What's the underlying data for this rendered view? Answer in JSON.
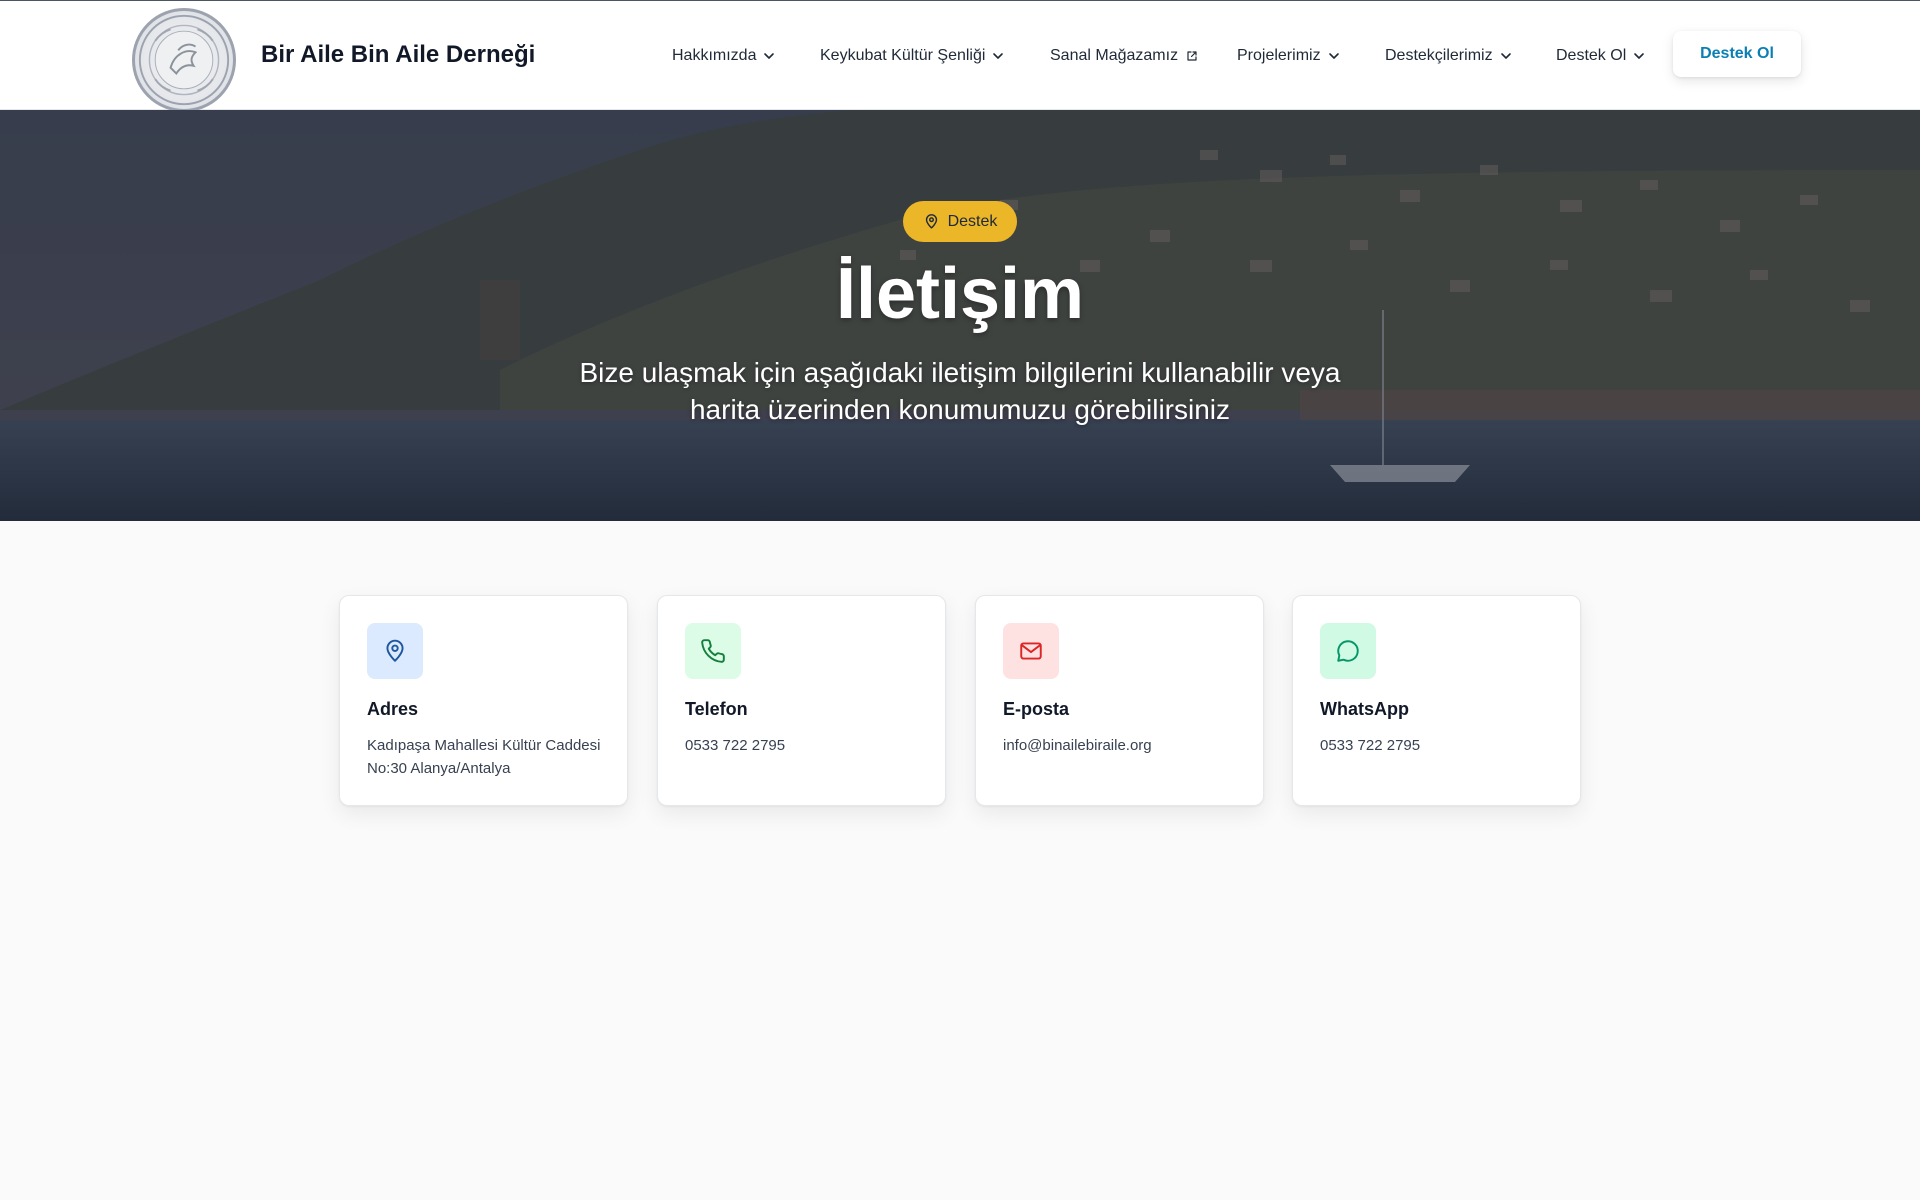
{
  "header": {
    "brand": "Bir Aile Bin Aile Derneği",
    "logo_icon": "organization-seal-logo",
    "nav": [
      {
        "label": "Hakkımızda",
        "icon": "chevron-down-icon"
      },
      {
        "label": "Keykubat Kültür Şenliği",
        "icon": "chevron-down-icon"
      },
      {
        "label": "Sanal Mağazamız",
        "icon": "external-link-icon"
      },
      {
        "label": "Projelerimiz",
        "icon": "chevron-down-icon"
      },
      {
        "label": "Destekçilerimiz",
        "icon": "chevron-down-icon"
      },
      {
        "label": "Destek Ol",
        "icon": "chevron-down-icon"
      }
    ],
    "cta_label": "Destek Ol"
  },
  "hero": {
    "badge_label": "Destek",
    "badge_icon": "map-pin-icon",
    "title": "İletişim",
    "subtitle": "Bize ulaşmak için aşağıdaki iletişim bilgilerini kullanabilir veya harita üzerinden konumumuzu görebilirsiniz"
  },
  "cards": [
    {
      "title": "Adres",
      "text": "Kadıpaşa Mahallesi Kültür Caddesi No:30 Alanya/Antalya",
      "icon": "map-pin-icon"
    },
    {
      "title": "Telefon",
      "text": "0533 722 2795",
      "icon": "phone-icon"
    },
    {
      "title": "E-posta",
      "text": "info@binailebiraile.org",
      "icon": "mail-icon"
    },
    {
      "title": "WhatsApp",
      "text": "0533 722 2795",
      "icon": "whatsapp-icon"
    }
  ],
  "colors": {
    "accent": "#0b7fb4",
    "badge": "#ecb629",
    "address_icon_bg": "#dbeafe",
    "address_icon": "#1e56a0",
    "phone_icon_bg": "#dcfce7",
    "phone_icon": "#15803d",
    "mail_icon_bg": "#fee2e2",
    "mail_icon": "#dc2626",
    "whatsapp_icon_bg": "#d1fae5",
    "whatsapp_icon": "#059669"
  }
}
